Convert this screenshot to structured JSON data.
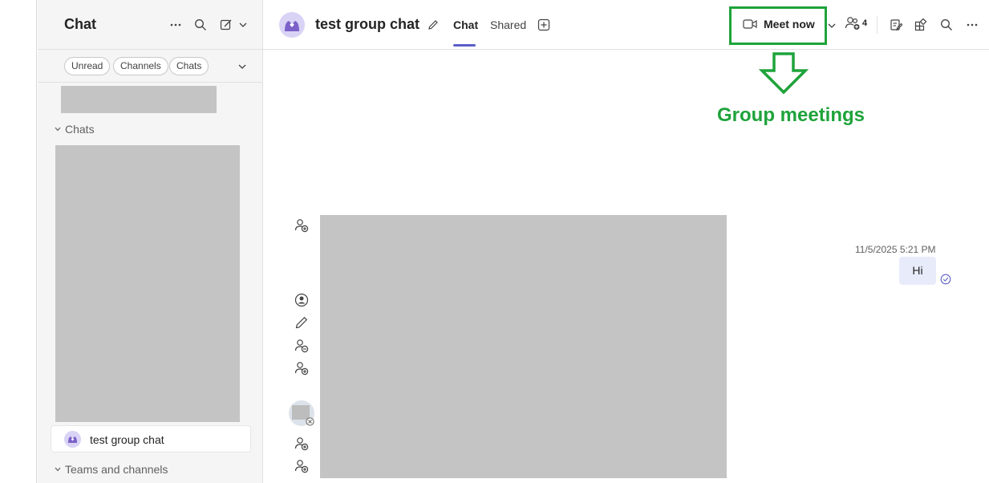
{
  "sidebar": {
    "title": "Chat",
    "filters": [
      "Unread",
      "Channels",
      "Chats"
    ],
    "sections": {
      "chats": "Chats",
      "teams": "Teams and channels"
    },
    "selected_chat": "test group chat"
  },
  "header": {
    "chat_title": "test group chat",
    "tabs": [
      {
        "label": "Chat",
        "active": true
      },
      {
        "label": "Shared",
        "active": false
      }
    ],
    "meet_now_label": "Meet now",
    "participants_count": "4"
  },
  "annotation": {
    "text": "Group meetings",
    "color": "#1ea33a"
  },
  "message": {
    "timestamp": "11/5/2025 5:21 PM",
    "text": "Hi"
  },
  "colors": {
    "accent": "#5b5fc7",
    "bubble": "#e8ebfa",
    "annotation_green": "#1ea33a"
  }
}
